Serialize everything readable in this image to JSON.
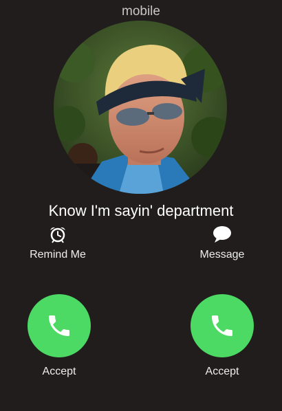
{
  "header": {
    "line_label": "mobile"
  },
  "caller": {
    "name": "Know I'm sayin' department"
  },
  "actions": {
    "remind": {
      "label": "Remind Me",
      "icon": "alarm-clock-icon"
    },
    "message": {
      "label": "Message",
      "icon": "speech-bubble-icon"
    }
  },
  "buttons": {
    "left": {
      "label": "Accept",
      "icon": "phone-icon"
    },
    "right": {
      "label": "Accept",
      "icon": "phone-icon"
    }
  },
  "colors": {
    "background": "#211d1d",
    "accept_green": "#4cd964"
  }
}
